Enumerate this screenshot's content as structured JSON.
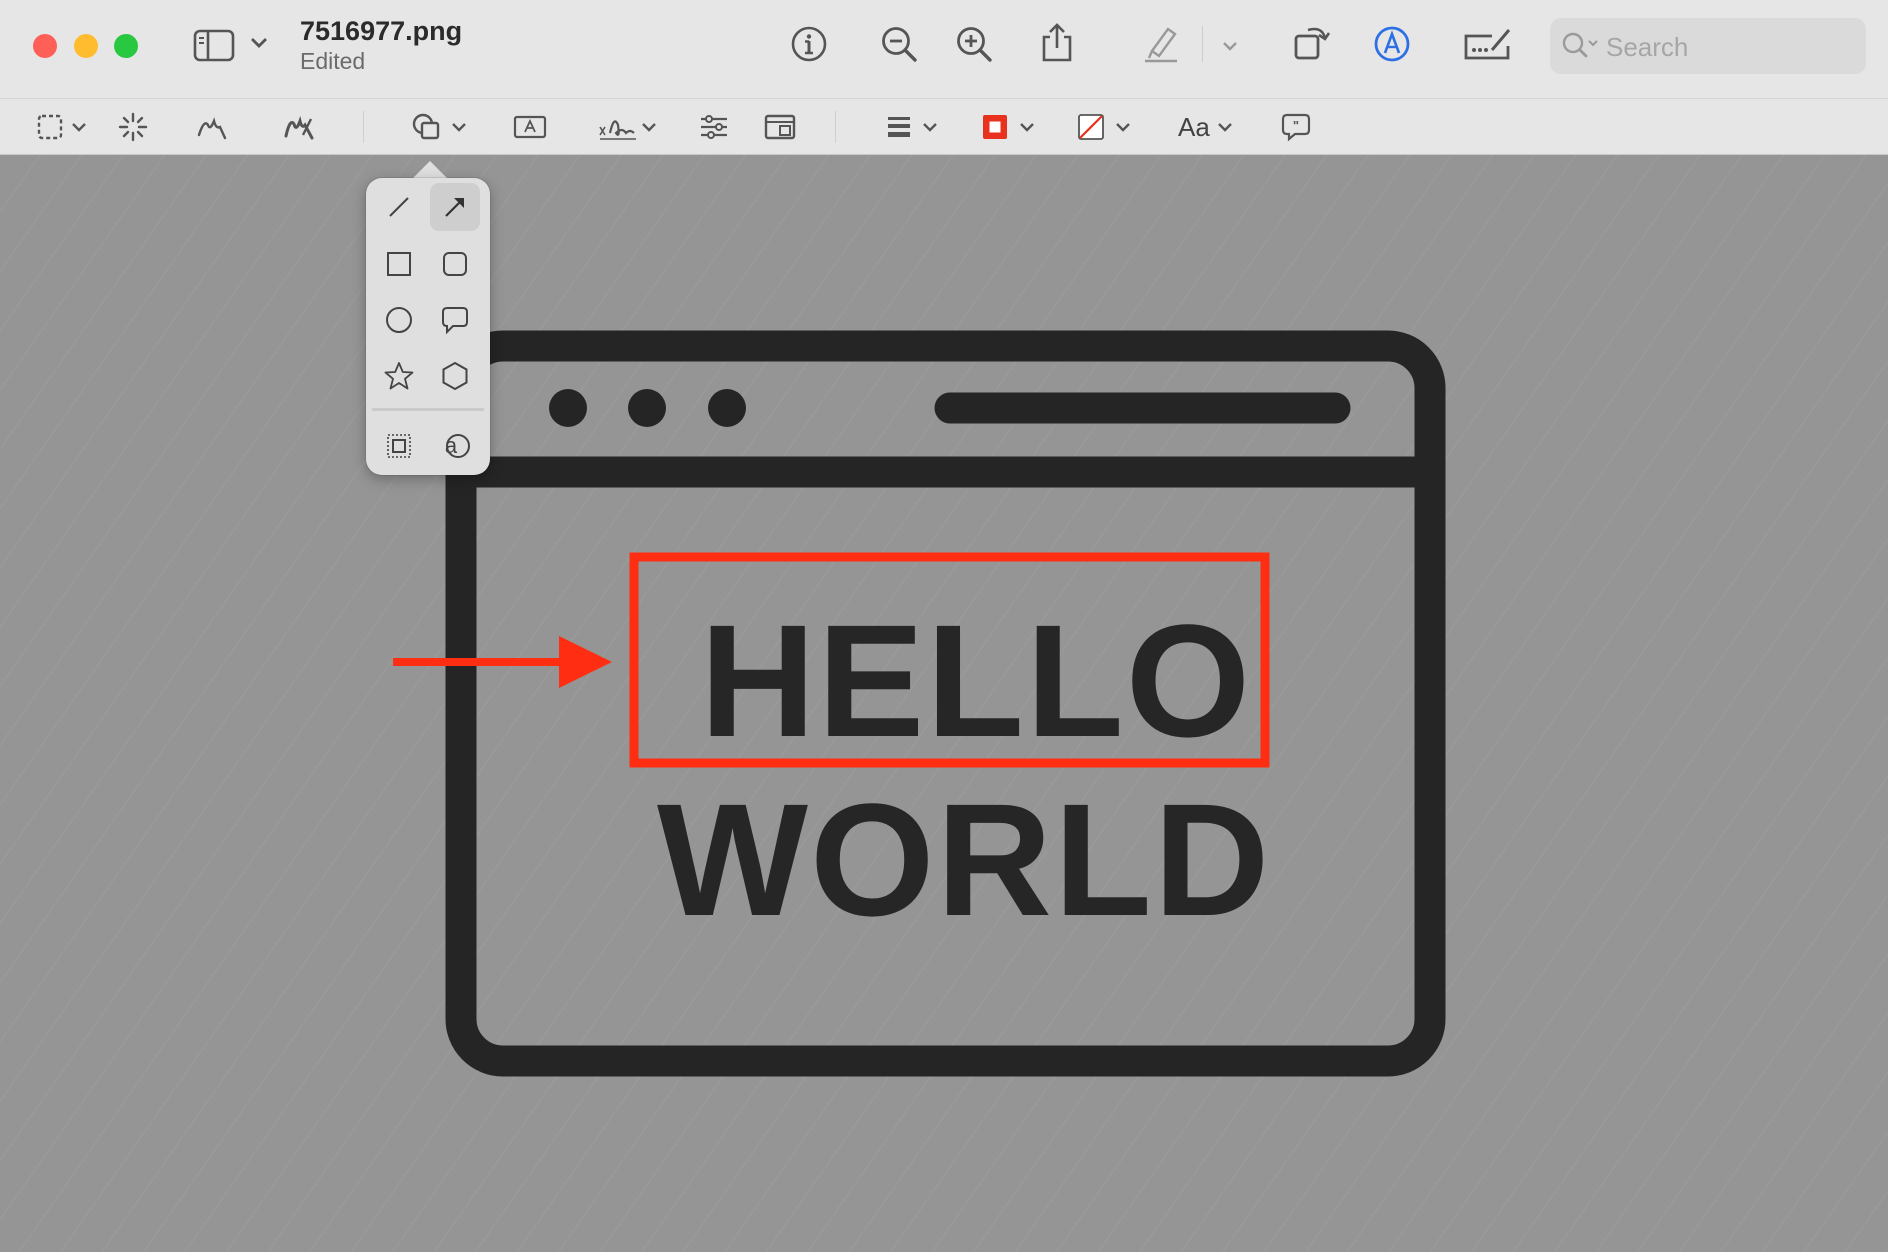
{
  "window": {
    "filename": "7516977.png",
    "status": "Edited",
    "traffic_lights": {
      "close": "#fe5f57",
      "minimize": "#febc2e",
      "zoom": "#28c840"
    }
  },
  "toolbar": {
    "icons": [
      "sidebar-toggle-icon",
      "info-icon",
      "zoom-out-icon",
      "zoom-in-icon",
      "share-icon",
      "highlight-pen-icon",
      "rotate-icon",
      "markup-icon",
      "form-fill-icon"
    ],
    "search_placeholder": "Search"
  },
  "markup_toolbar": {
    "tools": [
      "rectangular-selection",
      "instant-alpha",
      "sketch",
      "draw",
      "shapes",
      "text",
      "sign",
      "adjust-color",
      "adjust-size",
      "shape-style",
      "border-color",
      "fill-color",
      "text-style",
      "annotate"
    ],
    "text_style_label": "Aa",
    "border_color": "#e8321d",
    "accent": "#2d6fe5"
  },
  "shapes_popover": {
    "items": [
      "line",
      "arrow",
      "rectangle",
      "rounded-rectangle",
      "oval",
      "speech-bubble",
      "star",
      "polygon",
      "mask",
      "loupe"
    ],
    "selected": "arrow"
  },
  "document": {
    "headline": "HELLO",
    "subline": "WORLD",
    "annotation_color": "#ff2e12"
  }
}
